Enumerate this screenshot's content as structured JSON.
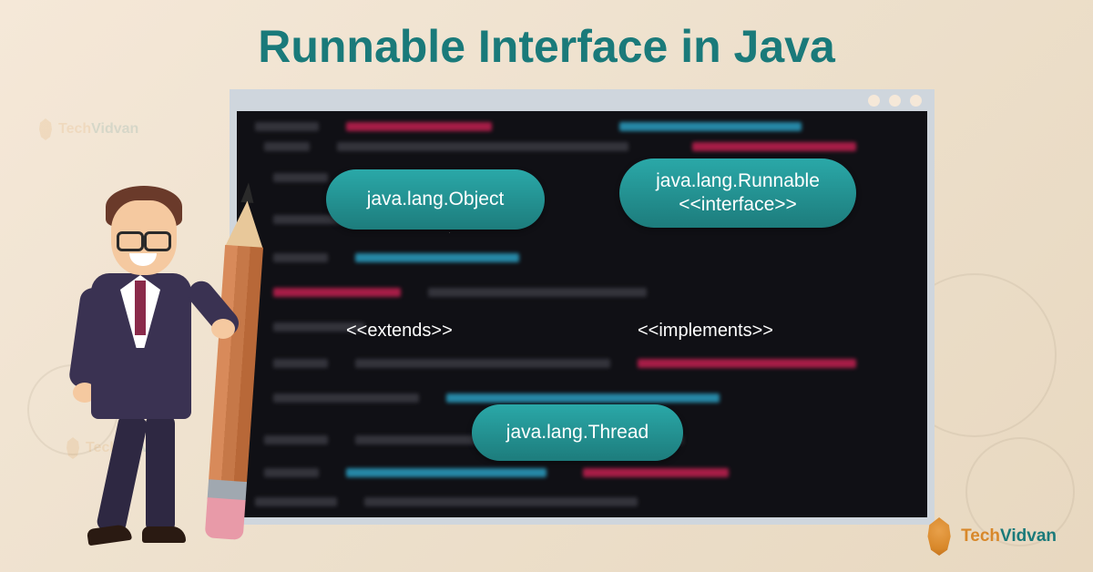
{
  "title": "Runnable Interface in Java",
  "brand": {
    "part1": "Tech",
    "part2": "Vidvan"
  },
  "diagram": {
    "node_object": "java.lang.Object",
    "node_runnable_line1": "java.lang.Runnable",
    "node_runnable_line2": "<<interface>>",
    "node_thread": "java.lang.Thread",
    "rel_extends": "<<extends>>",
    "rel_implements": "<<implements>>"
  }
}
